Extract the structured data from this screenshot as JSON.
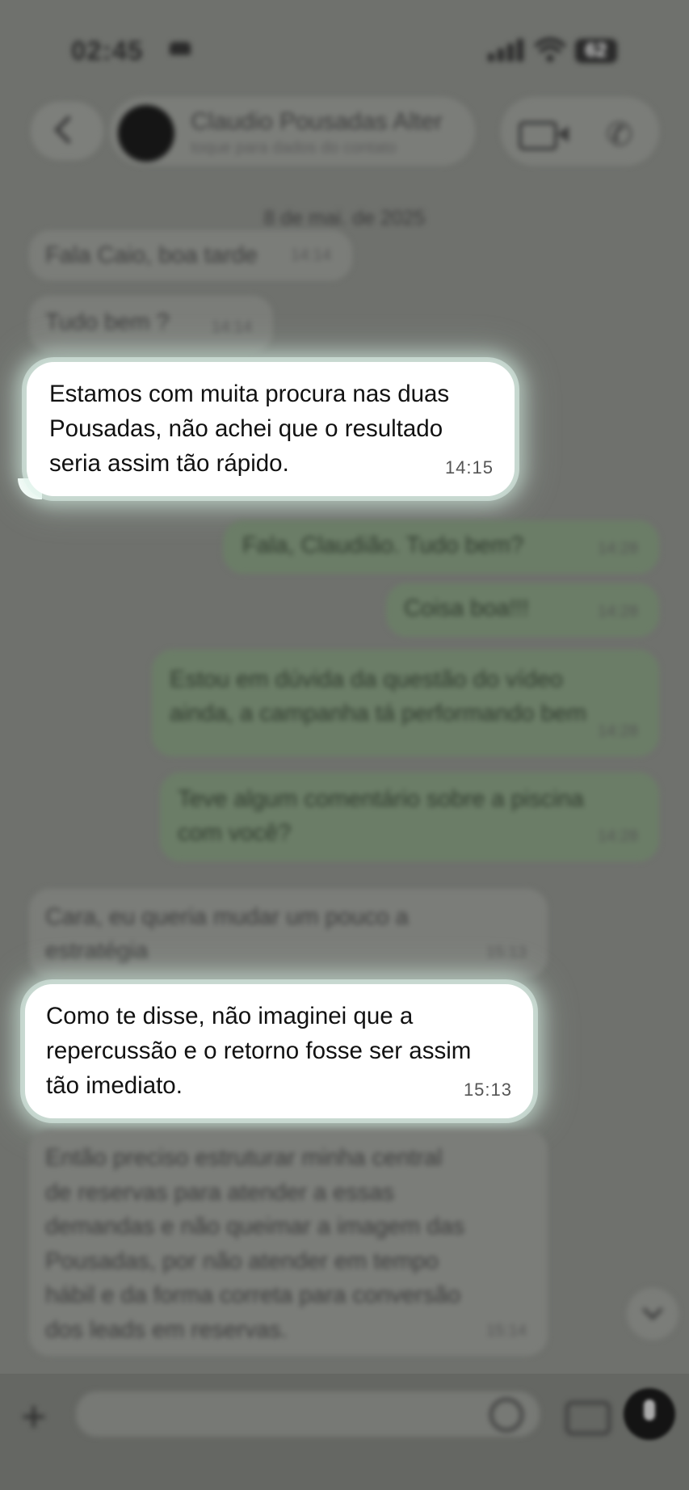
{
  "status_bar": {
    "time": "02:45",
    "battery": "62"
  },
  "header": {
    "contact_name": "Claudio Pousadas Alter",
    "contact_subtitle": "toque para dados do contato",
    "icons": [
      "back-icon",
      "video-call-icon",
      "phone-icon"
    ]
  },
  "date_divider": "8 de mai. de 2025",
  "messages": [
    {
      "dir": "in",
      "text": "Fala Caio, boa tarde",
      "time": "14:14"
    },
    {
      "dir": "in",
      "text": "Tudo bem ?",
      "time": "14:14"
    },
    {
      "dir": "in",
      "lines": [
        "Estamos com muita procura nas duas",
        "Pousadas, não achei que o resultado",
        "seria assim tão rápido."
      ],
      "time": "14:15"
    },
    {
      "dir": "out",
      "text": "Fala, Claudião. Tudo bem?",
      "time": "14:28"
    },
    {
      "dir": "out",
      "text": "Coisa boa!!!",
      "time": "14:28"
    },
    {
      "dir": "out",
      "lines": [
        "Estou em dúvida da questão do vídeo",
        "ainda, a campanha tá performando bem"
      ],
      "time": "14:28"
    },
    {
      "dir": "out",
      "lines": [
        "Teve algum comentário sobre a piscina",
        "com você?"
      ],
      "time": "14:28"
    },
    {
      "dir": "in",
      "lines": [
        "Cara, eu queria mudar um pouco a",
        "estratégia"
      ],
      "time": "15:13"
    },
    {
      "dir": "in",
      "lines": [
        "Como te disse, não imaginei que a",
        "repercussão e o retorno fosse ser assim",
        "tão imediato."
      ],
      "time": "15:13"
    },
    {
      "dir": "in",
      "lines": [
        "Então preciso estruturar minha central",
        "de reservas para atender a essas",
        "demandas e não queimar a imagem das",
        "Pousadas, por não atender em tempo",
        "hábil e da forma correta para conversão",
        "dos leads em reservas."
      ],
      "time": "15:14"
    }
  ],
  "composer": {
    "placeholder": ""
  },
  "colors": {
    "highlight_bubble": "#ffffff",
    "outgoing_bubble": "#6b7d67",
    "background": "#6f716d"
  }
}
